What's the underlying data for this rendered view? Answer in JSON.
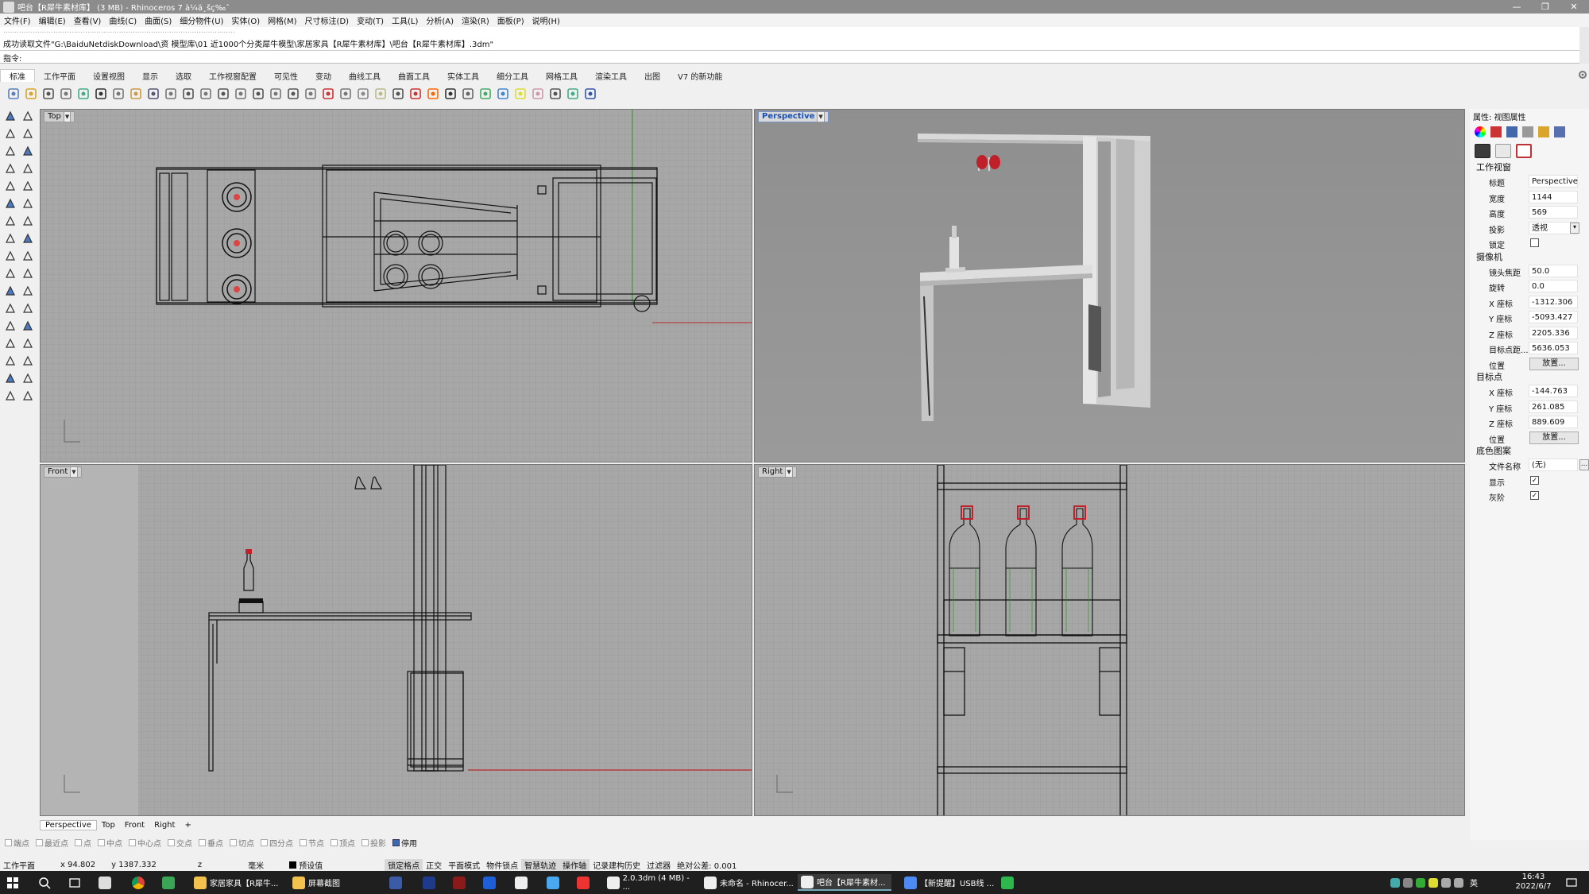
{
  "window": {
    "title": "吧台【R犀牛素材库】 (3 MB) - Rhinoceros 7 à¼ä¸šç‰ˆ",
    "controls": [
      "—",
      "❐",
      "✕"
    ]
  },
  "menu": [
    "文件(F)",
    "编辑(E)",
    "查看(V)",
    "曲线(C)",
    "曲面(S)",
    "细分物件(U)",
    "实体(O)",
    "网格(M)",
    "尺寸标注(D)",
    "变动(T)",
    "工具(L)",
    "分析(A)",
    "渲染(R)",
    "面板(P)",
    "说明(H)"
  ],
  "command": {
    "history_line": "成功读取文件\"G:\\BaiduNetdiskDownload\\资 模型库\\01 近1000个分类犀牛模型\\家居家具【R犀牛素材库】\\吧台【R犀牛素材库】.3dm\"",
    "prompt": "指令:"
  },
  "toolbar_tabs": [
    "标准",
    "工作平面",
    "设置视图",
    "显示",
    "选取",
    "工作视窗配置",
    "可见性",
    "变动",
    "曲线工具",
    "曲面工具",
    "实体工具",
    "细分工具",
    "网格工具",
    "渲染工具",
    "出图",
    "V7 的新功能"
  ],
  "toolbar_icons": [
    "new-file-icon",
    "open-icon",
    "save-icon",
    "print-icon",
    "export-icon",
    "cut-icon",
    "copy-icon",
    "paste-icon",
    "undo-icon",
    "pan-icon",
    "move-icon",
    "zoom-icon",
    "zoom-window-icon",
    "zoom-extents-icon",
    "zoom-selected-icon",
    "rotate-view-icon",
    "four-view-icon",
    "plane-icon",
    "grid-icon",
    "properties-icon",
    "named-view-icon",
    "lightbulb-icon",
    "lock-icon",
    "layer-icon",
    "color-wheel-icon",
    "shaded-icon",
    "rendered-icon",
    "material-icon",
    "render-icon",
    "options-icon",
    "gear-icon",
    "align-icon",
    "globe-icon",
    "help-icon"
  ],
  "viewports": {
    "top": {
      "label": "Top"
    },
    "perspective": {
      "label": "Perspective"
    },
    "front": {
      "label": "Front"
    },
    "right": {
      "label": "Right"
    }
  },
  "properties": {
    "title": "属性: 视图属性",
    "sections": {
      "viewport": "工作视窗",
      "camera": "摄像机",
      "target": "目标点",
      "wallpaper": "底色图案"
    },
    "viewport_rows": [
      {
        "label": "标题",
        "value": "Perspective"
      },
      {
        "label": "宽度",
        "value": "1144"
      },
      {
        "label": "高度",
        "value": "569"
      },
      {
        "label": "投影",
        "value": "透视"
      },
      {
        "label": "锁定",
        "value": ""
      }
    ],
    "camera_rows": [
      {
        "label": "镜头焦距",
        "value": "50.0"
      },
      {
        "label": "旋转",
        "value": "0.0"
      },
      {
        "label": "X 座标",
        "value": "-1312.306"
      },
      {
        "label": "Y 座标",
        "value": "-5093.427"
      },
      {
        "label": "Z 座标",
        "value": "2205.336"
      },
      {
        "label": "目标点距...",
        "value": "5636.053"
      },
      {
        "label": "位置",
        "value": "放置..."
      }
    ],
    "target_rows": [
      {
        "label": "X 座标",
        "value": "-144.763"
      },
      {
        "label": "Y 座标",
        "value": "261.085"
      },
      {
        "label": "Z 座标",
        "value": "889.609"
      },
      {
        "label": "位置",
        "value": "放置..."
      }
    ],
    "wallpaper_rows": [
      {
        "label": "文件名称",
        "value": "(无)",
        "button": "..."
      },
      {
        "label": "显示",
        "checked": true
      },
      {
        "label": "灰阶",
        "checked": true
      }
    ]
  },
  "viewport_tabs": [
    "Perspective",
    "Top",
    "Front",
    "Right",
    "+"
  ],
  "osnaps": [
    {
      "label": "端点",
      "on": false
    },
    {
      "label": "最近点",
      "on": false
    },
    {
      "label": "点",
      "on": false
    },
    {
      "label": "中点",
      "on": false
    },
    {
      "label": "中心点",
      "on": false
    },
    {
      "label": "交点",
      "on": false
    },
    {
      "label": "垂点",
      "on": false
    },
    {
      "label": "切点",
      "on": false
    },
    {
      "label": "四分点",
      "on": false
    },
    {
      "label": "节点",
      "on": false
    },
    {
      "label": "顶点",
      "on": false
    },
    {
      "label": "投影",
      "on": false
    },
    {
      "label": "停用",
      "on": true
    }
  ],
  "status": {
    "cplane": "工作平面",
    "x": "x 94.802",
    "y": "y 1387.332",
    "z": "z",
    "units": "毫米",
    "layer": "预设值",
    "items": [
      {
        "label": "锁定格点",
        "hl": true
      },
      {
        "label": "正交",
        "hl": false
      },
      {
        "label": "平面模式",
        "hl": false
      },
      {
        "label": "物件锁点",
        "hl": false
      },
      {
        "label": "智慧轨迹",
        "hl": true
      },
      {
        "label": "操作轴",
        "hl": true
      },
      {
        "label": "记录建构历史",
        "hl": false
      },
      {
        "label": "过滤器",
        "hl": false
      },
      {
        "label": "绝对公差: 0.001",
        "hl": false
      }
    ]
  },
  "taskbar": {
    "apps": [
      {
        "label": "家居家具【R犀牛...",
        "color": "#f2c14e"
      },
      {
        "label": "屏幕截图",
        "color": "#f2c14e"
      },
      {
        "label": "2.0.3dm (4 MB) - ...",
        "color": "#eeeeee"
      },
      {
        "label": "未命名 - Rhinocer...",
        "color": "#eeeeee"
      },
      {
        "label": "吧台【R犀牛素材...",
        "color": "#eeeeee"
      },
      {
        "label": "【新提醒】USB线 ...",
        "color": "#4c8bf5"
      }
    ],
    "time": "16:43",
    "date": "2022/6/7",
    "ime": "英"
  }
}
